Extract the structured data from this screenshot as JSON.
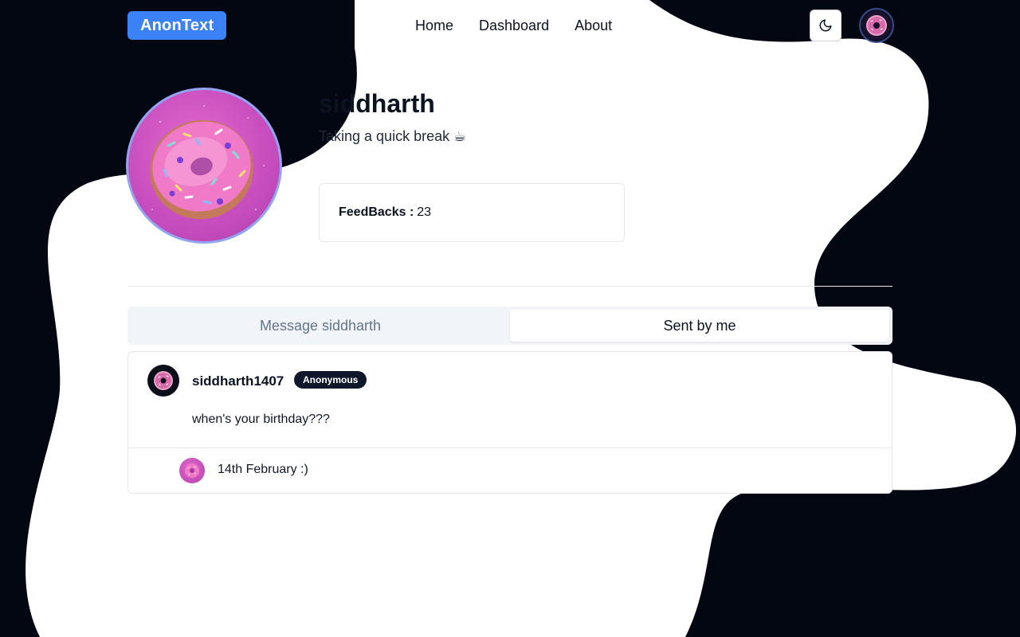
{
  "app": {
    "brand": "AnonText"
  },
  "nav": {
    "items": [
      "Home",
      "Dashboard",
      "About"
    ]
  },
  "icons": {
    "theme_toggle": "moon-icon",
    "nav_avatar": "donut-avatar",
    "profile_avatar": "donut-avatar"
  },
  "profile": {
    "username": "siddharth",
    "status": "Taking a quick break ☕",
    "feedbacks_label": "FeedBacks :",
    "feedbacks_count": "23"
  },
  "tabs": [
    {
      "label": "Message siddharth",
      "active": false
    },
    {
      "label": "Sent by me",
      "active": true
    }
  ],
  "messages": [
    {
      "sender": "siddharth1407",
      "badge": "Anonymous",
      "text": "when's your birthday???",
      "reply": "14th February :)"
    }
  ],
  "colors": {
    "brand": "#3b82f6",
    "background_dark": "#030712",
    "surface": "#ffffff",
    "badge": "#0f172a",
    "avatar_pink": "#c94fbf"
  }
}
